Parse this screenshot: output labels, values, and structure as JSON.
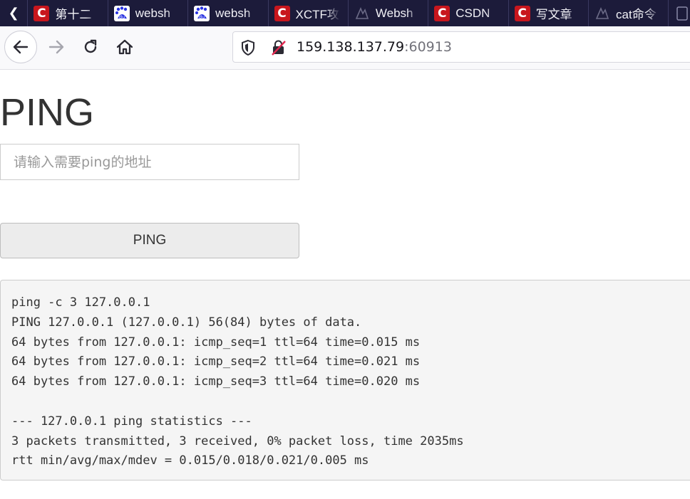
{
  "browser": {
    "tabs": [
      {
        "label": "第十二",
        "favicon": "csdn-icon"
      },
      {
        "label": "websh",
        "favicon": "baidu-icon"
      },
      {
        "label": "websh",
        "favicon": "baidu-icon"
      },
      {
        "label": "XCTF攻",
        "favicon": "csdn-icon"
      },
      {
        "label": "Websh",
        "favicon": "ghost-icon"
      },
      {
        "label": "CSDN",
        "favicon": "csdn-icon"
      },
      {
        "label": "写文章",
        "favicon": "csdn-icon"
      },
      {
        "label": "cat命令",
        "favicon": "ghost-icon"
      }
    ],
    "favicon_glyphs": {
      "csdn": "C",
      "baidu": "du"
    },
    "url_host": "159.138.137.79",
    "url_port": ":60913",
    "colors": {
      "tab_bar": "#1c1b3a",
      "csdn_red": "#c8161d",
      "baidu_blue": "#2932e1"
    }
  },
  "page": {
    "title": "PING",
    "input_placeholder": "请输入需要ping的地址",
    "button_label": "PING",
    "output_lines": [
      "ping -c 3 127.0.0.1",
      "PING 127.0.0.1 (127.0.0.1) 56(84) bytes of data.",
      "64 bytes from 127.0.0.1: icmp_seq=1 ttl=64 time=0.015 ms",
      "64 bytes from 127.0.0.1: icmp_seq=2 ttl=64 time=0.021 ms",
      "64 bytes from 127.0.0.1: icmp_seq=3 ttl=64 time=0.020 ms",
      "",
      "--- 127.0.0.1 ping statistics ---",
      "3 packets transmitted, 3 received, 0% packet loss, time 2035ms",
      "rtt min/avg/max/mdev = 0.015/0.018/0.021/0.005 ms"
    ]
  }
}
